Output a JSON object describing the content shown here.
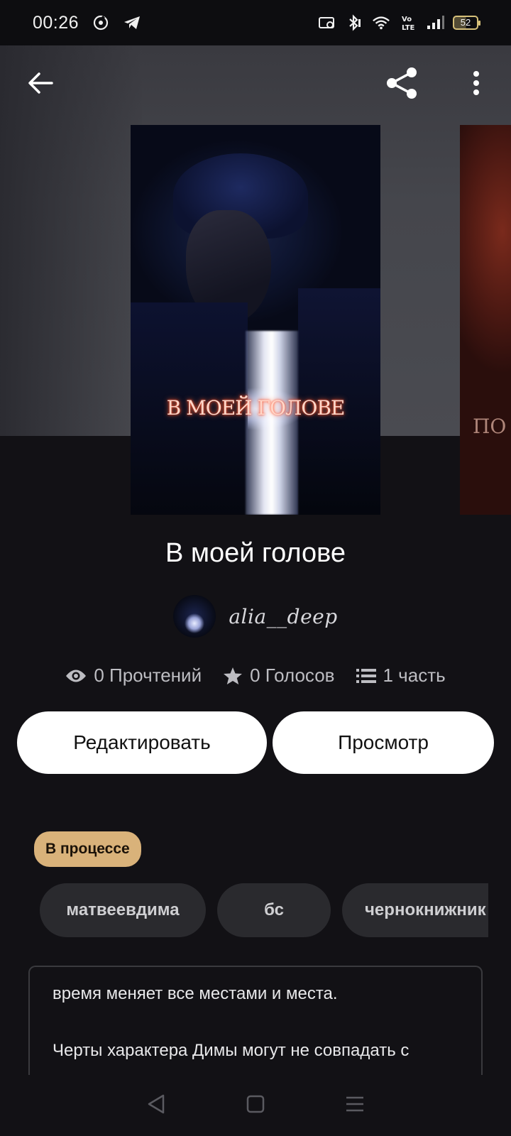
{
  "status_bar": {
    "time": "00:26",
    "battery": "52",
    "icons": [
      "music-app-icon",
      "telegram-icon",
      "screen-cast-icon",
      "bluetooth-icon",
      "wifi-icon",
      "volte-icon",
      "signal-icon"
    ]
  },
  "toolbar": {
    "back_icon": "arrow-left-icon",
    "share_icon": "share-icon",
    "menu_icon": "more-vertical-icon"
  },
  "cover": {
    "title_text": "В МОЕЙ ГОЛОВЕ",
    "next_cover_text": "ПО Е"
  },
  "story": {
    "title": "В моей голове",
    "author": "alia__deep"
  },
  "stats": {
    "reads": "0 Прочтений",
    "votes": "0 Голосов",
    "parts": "1 часть"
  },
  "actions": {
    "edit_label": "Редактировать",
    "view_label": "Просмотр"
  },
  "status_badge": "В процессе",
  "tags": [
    "матвеевдима",
    "бс",
    "чернокнижник"
  ],
  "description": {
    "line1": "время меняет все местами и места.",
    "line2": "Черты характера Димы могут не совпадать с реальными."
  },
  "nav": [
    "back-triangle-icon",
    "home-square-icon",
    "recents-menu-icon"
  ],
  "colors": {
    "background": "#121115",
    "badge": "#d9b27a",
    "tag_bg": "#2a2a2e",
    "button_bg": "#ffffff"
  }
}
